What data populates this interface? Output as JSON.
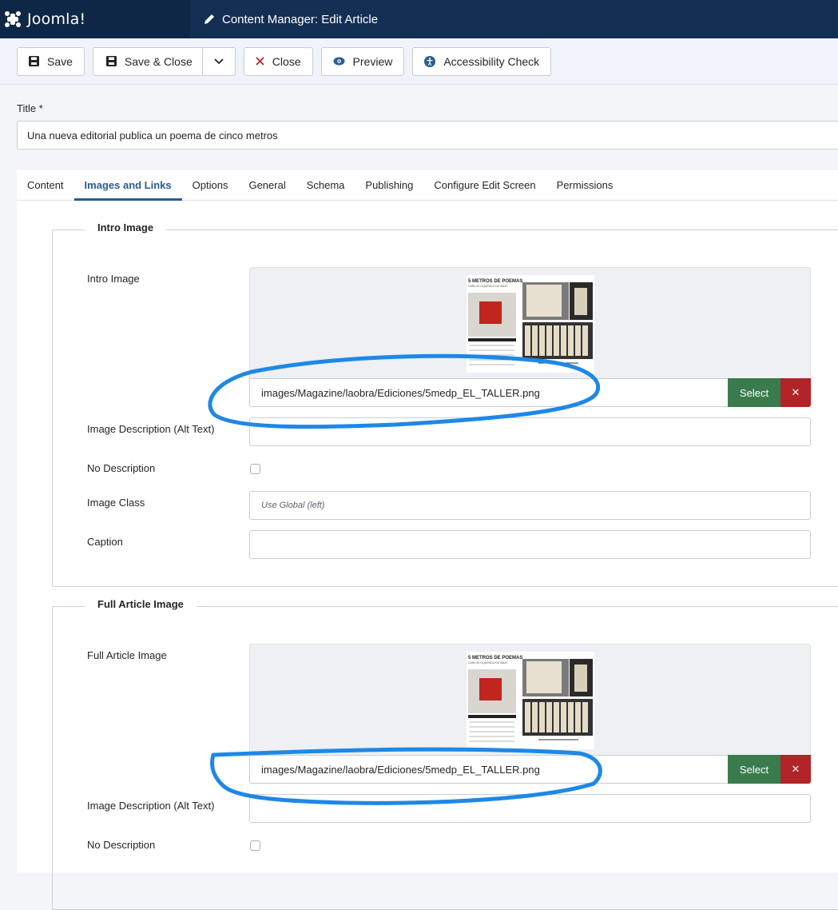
{
  "app": {
    "brand": "Joomla!",
    "page_title": "Content Manager: Edit Article"
  },
  "toolbar": {
    "save": "Save",
    "save_close": "Save & Close",
    "close": "Close",
    "preview": "Preview",
    "accessibility": "Accessibility Check"
  },
  "title_field": {
    "label": "Title *",
    "value": "Una nueva editorial publica un poema de cinco metros"
  },
  "tabs": [
    "Content",
    "Images and Links",
    "Options",
    "General",
    "Schema",
    "Publishing",
    "Configure Edit Screen",
    "Permissions"
  ],
  "active_tab": "Images and Links",
  "intro": {
    "legend": "Intro Image",
    "image_label": "Intro Image",
    "path": "images/Magazine/laobra/Ediciones/5medp_EL_TALLER.png",
    "select": "Select",
    "clear": "✕",
    "alt_label": "Image Description (Alt Text)",
    "alt_value": "",
    "no_desc_label": "No Description",
    "no_desc_checked": false,
    "class_label": "Image Class",
    "class_placeholder": "Use Global (left)",
    "caption_label": "Caption",
    "caption_value": ""
  },
  "full": {
    "legend": "Full Article Image",
    "image_label": "Full Article Image",
    "path": "images/Magazine/laobra/Ediciones/5medp_EL_TALLER.png",
    "select": "Select",
    "clear": "✕",
    "alt_label": "Image Description (Alt Text)",
    "alt_value": "",
    "no_desc_label": "No Description",
    "no_desc_checked": false
  },
  "thumbnail": {
    "heading": "5 METROS DE POEMAS",
    "subheading": "CARLOS OQUENDO DE AMAT"
  },
  "colors": {
    "header": "#132f53",
    "brand_bg": "#0f2746",
    "accent": "#2a5e8f",
    "select": "#3a7b4e",
    "clear": "#b22427",
    "annotation": "#1e88e5"
  }
}
